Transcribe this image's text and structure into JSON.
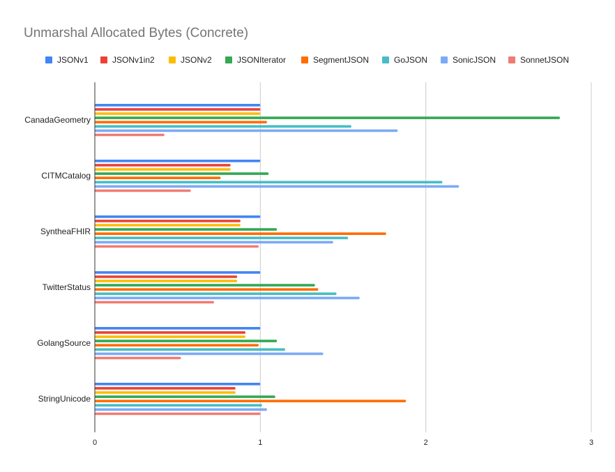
{
  "chart_data": {
    "type": "bar",
    "orientation": "horizontal",
    "title": "Unmarshal Allocated Bytes (Concrete)",
    "categories": [
      "CanadaGeometry",
      "CITMCatalog",
      "SyntheaFHIR",
      "TwitterStatus",
      "GolangSource",
      "StringUnicode"
    ],
    "series": [
      {
        "name": "JSONv1",
        "color": "#4285f4",
        "values": [
          1.0,
          1.0,
          1.0,
          1.0,
          1.0,
          1.0
        ]
      },
      {
        "name": "JSONv1in2",
        "color": "#ea4335",
        "values": [
          1.0,
          0.82,
          0.88,
          0.86,
          0.91,
          0.85
        ]
      },
      {
        "name": "JSONv2",
        "color": "#fbbc04",
        "values": [
          1.0,
          0.82,
          0.88,
          0.86,
          0.91,
          0.85
        ]
      },
      {
        "name": "JSONIterator",
        "color": "#34a853",
        "values": [
          2.81,
          1.05,
          1.1,
          1.33,
          1.1,
          1.09
        ]
      },
      {
        "name": "SegmentJSON",
        "color": "#ff6d01",
        "values": [
          1.04,
          0.76,
          1.76,
          1.35,
          0.99,
          1.88
        ]
      },
      {
        "name": "GoJSON",
        "color": "#46bdc6",
        "values": [
          1.55,
          2.1,
          1.53,
          1.46,
          1.15,
          1.01
        ]
      },
      {
        "name": "SonicJSON",
        "color": "#7baaf7",
        "values": [
          1.83,
          2.2,
          1.44,
          1.6,
          1.38,
          1.04
        ]
      },
      {
        "name": "SonnetJSON",
        "color": "#f07b72",
        "values": [
          0.42,
          0.58,
          0.99,
          0.72,
          0.52,
          1.0
        ]
      }
    ],
    "xlim": [
      0,
      3
    ],
    "xticks": [
      "0",
      "1",
      "2",
      "3"
    ],
    "grid": true,
    "legend_position": "top"
  }
}
